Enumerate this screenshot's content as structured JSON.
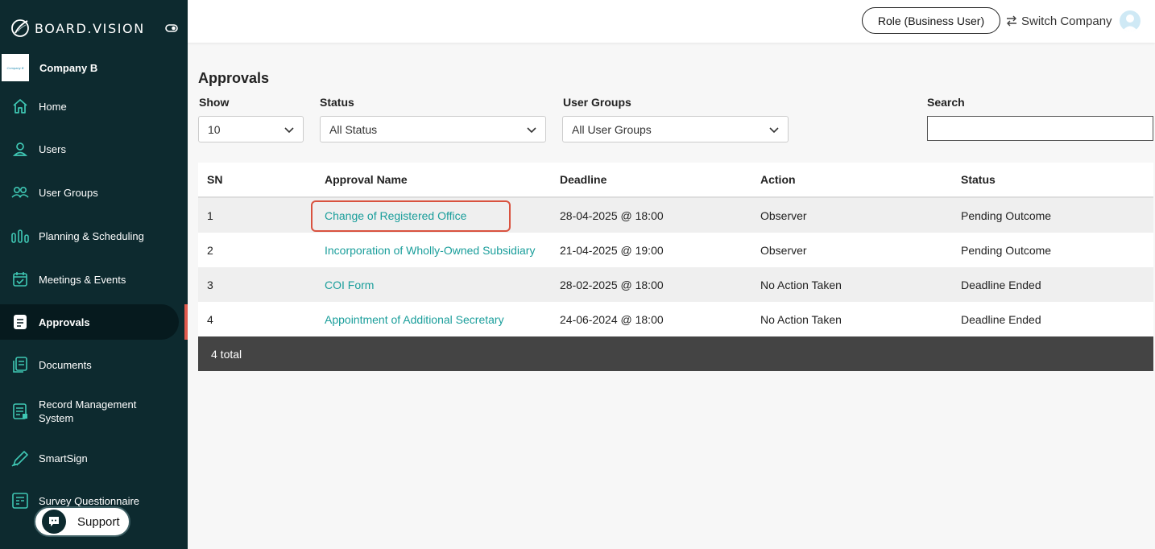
{
  "brand": {
    "name": "BOARD.VISION"
  },
  "company": {
    "name": "Company B",
    "logo_text": "Company B"
  },
  "sidebar": {
    "items": [
      {
        "label": "Home",
        "icon": "home-icon"
      },
      {
        "label": "Users",
        "icon": "user-icon"
      },
      {
        "label": "User Groups",
        "icon": "users-icon"
      },
      {
        "label": "Planning & Scheduling",
        "icon": "bars-chart-icon"
      },
      {
        "label": "Meetings & Events",
        "icon": "calendar-check-icon"
      },
      {
        "label": "Approvals",
        "icon": "document-icon",
        "active": true
      },
      {
        "label": "Documents",
        "icon": "documents-icon"
      },
      {
        "label": "Record Management System",
        "icon": "record-icon"
      },
      {
        "label": "SmartSign",
        "icon": "pen-icon"
      },
      {
        "label": "Survey Questionnaire",
        "icon": "survey-icon"
      }
    ],
    "support_label": "Support"
  },
  "header": {
    "role_label": "Role (Business User)",
    "switch_label": "Switch Company"
  },
  "page": {
    "title": "Approvals",
    "filters": {
      "show_label": "Show",
      "show_value": "10",
      "status_label": "Status",
      "status_value": "All Status",
      "groups_label": "User Groups",
      "groups_value": "All User Groups",
      "search_label": "Search",
      "search_value": ""
    }
  },
  "table": {
    "columns": [
      "SN",
      "Approval Name",
      "Deadline",
      "Action",
      "Status"
    ],
    "rows": [
      {
        "sn": "1",
        "name": "Change of Registered Office",
        "deadline": "28-04-2025 @ 18:00",
        "action": "Observer",
        "status": "Pending Outcome"
      },
      {
        "sn": "2",
        "name": "Incorporation of Wholly-Owned Subsidiary",
        "deadline": "21-04-2025 @ 19:00",
        "action": "Observer",
        "status": "Pending Outcome"
      },
      {
        "sn": "3",
        "name": "COI Form",
        "deadline": "28-02-2025 @ 18:00",
        "action": "No Action Taken",
        "status": "Deadline Ended"
      },
      {
        "sn": "4",
        "name": "Appointment of Additional Secretary",
        "deadline": "24-06-2024 @ 18:00",
        "action": "No Action Taken",
        "status": "Deadline Ended"
      }
    ],
    "total_label": "4 total"
  },
  "colors": {
    "sidebar_bg": "#0d2a2f",
    "accent_teal": "#1a9e9b",
    "icon_teal": "#3fc7b4",
    "highlight_red": "#d9523f"
  }
}
